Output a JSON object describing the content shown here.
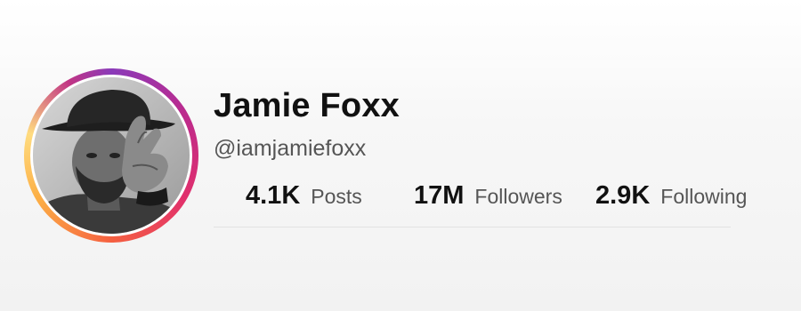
{
  "profile": {
    "name": "Jamie Foxx",
    "handle": "@iamjamiefoxx",
    "avatar_ring_colors": [
      "#8a3ab9",
      "#bc2a8d",
      "#e1306c",
      "#f56040",
      "#fcaf45",
      "#ffdc80"
    ]
  },
  "stats": [
    {
      "value": "4.1K",
      "label": "Posts"
    },
    {
      "value": "17M",
      "label": "Followers"
    },
    {
      "value": "2.9K",
      "label": "Following"
    }
  ]
}
